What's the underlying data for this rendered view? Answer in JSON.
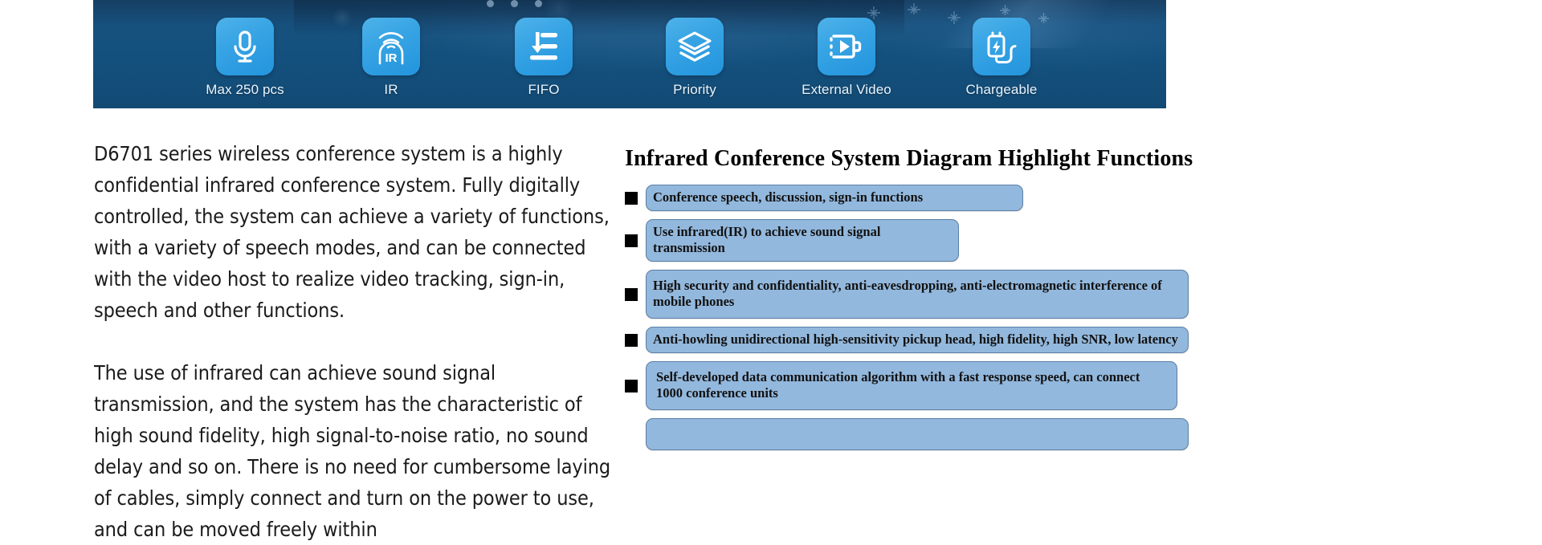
{
  "banner": {
    "features": [
      {
        "label": "Max 250 pcs",
        "icon": "microphone-icon"
      },
      {
        "label": "IR",
        "icon": "infrared-signal-icon"
      },
      {
        "label": "FIFO",
        "icon": "sort-list-icon"
      },
      {
        "label": "Priority",
        "icon": "layers-icon"
      },
      {
        "label": "External Video",
        "icon": "video-camera-icon"
      },
      {
        "label": "Chargeable",
        "icon": "battery-charge-icon"
      }
    ],
    "colors": {
      "background": "#13517f",
      "tile": "#2f9fe1",
      "label": "#eaf4fc"
    }
  },
  "left_column": {
    "paragraphs": [
      "D6701 series wireless conference system is a highly confidential infrared conference system. Fully digitally controlled, the system can achieve a variety of functions, with a variety of speech modes, and can be connected with the video host to realize video tracking, sign-in, speech and other functions.",
      "The use of infrared can achieve sound signal transmission, and the system has the characteristic of high sound fidelity, high signal-to-noise ratio, no sound delay and so on. There is no need for cumbersome laying of cables, simply connect and turn on the power to use, and can be moved freely within"
    ]
  },
  "right_column": {
    "title": "Infrared Conference System Diagram Highlight Functions",
    "bullets": [
      "Conference speech, discussion, sign-in functions",
      "Use infrared(IR) to achieve sound signal transmission",
      "High security and confidentiality, anti-eavesdropping, anti-electromagnetic interference of mobile phones",
      "Anti-howling unidirectional high-sensitivity pickup head, high fidelity, high SNR, low latency",
      "Self-developed data communication algorithm with a fast response speed, can  connect 1000 conference units",
      ""
    ],
    "colors": {
      "box_fill": "#93b8dd",
      "box_border": "#5b7fa6",
      "bullet_marker": "#000000"
    }
  }
}
